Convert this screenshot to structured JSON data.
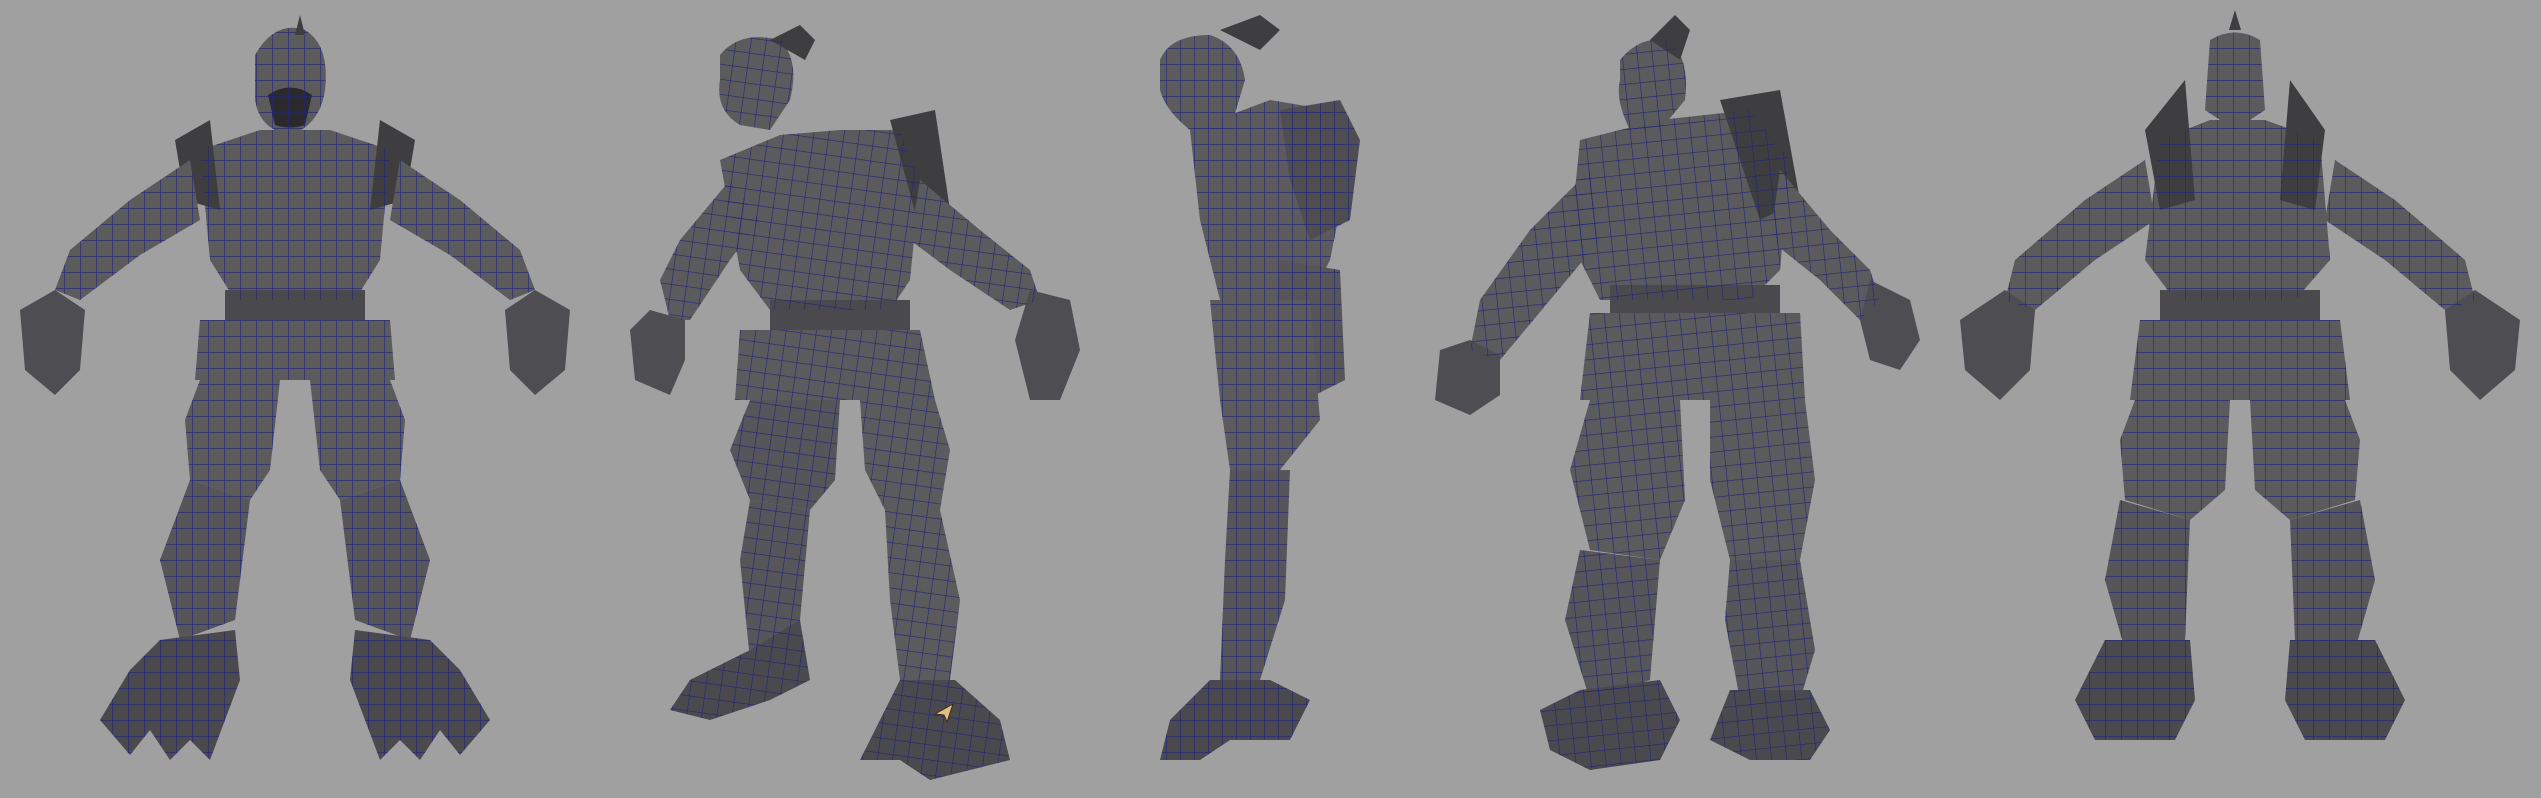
{
  "viewport": {
    "background_color": "#a0a0a0",
    "mesh_fill_color": "#5b5b5d",
    "mesh_shade_color": "#3e3e41",
    "mesh_highlight_color": "#75757a",
    "wire_color": "#23237a"
  },
  "views": [
    {
      "id": "front",
      "icon": "creature-mesh-front"
    },
    {
      "id": "three-quarter-front",
      "icon": "creature-mesh-three-quarter"
    },
    {
      "id": "side",
      "icon": "creature-mesh-side"
    },
    {
      "id": "three-quarter-back",
      "icon": "creature-mesh-three-quarter-back"
    },
    {
      "id": "back",
      "icon": "creature-mesh-back"
    }
  ],
  "cursor": {
    "icon": "arrow-cursor-icon",
    "color": "#e0c080"
  }
}
